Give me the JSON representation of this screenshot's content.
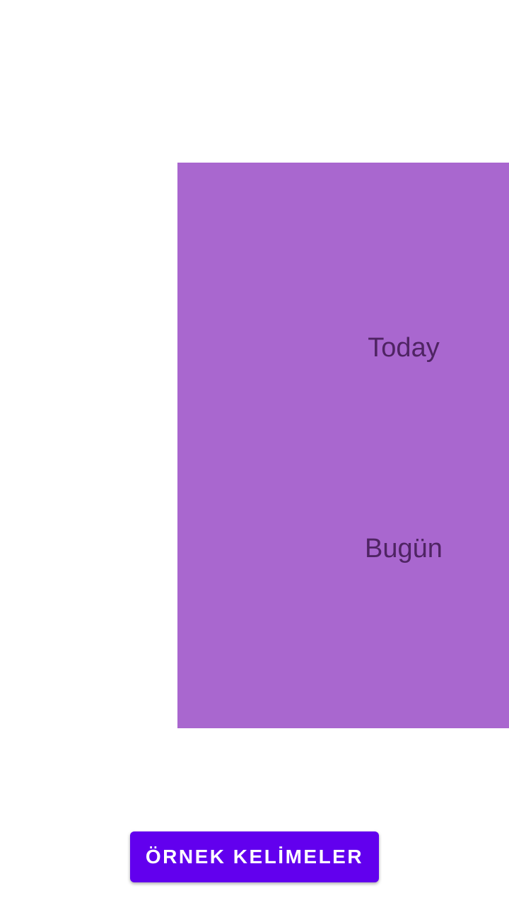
{
  "card": {
    "word": "Today",
    "translation": "Bugün",
    "background_color": "#a967cf",
    "text_color": "#4f2463"
  },
  "button": {
    "label": "ÖRNEK KELİMELER",
    "background_color": "#6200ee",
    "text_color": "#ffffff"
  }
}
